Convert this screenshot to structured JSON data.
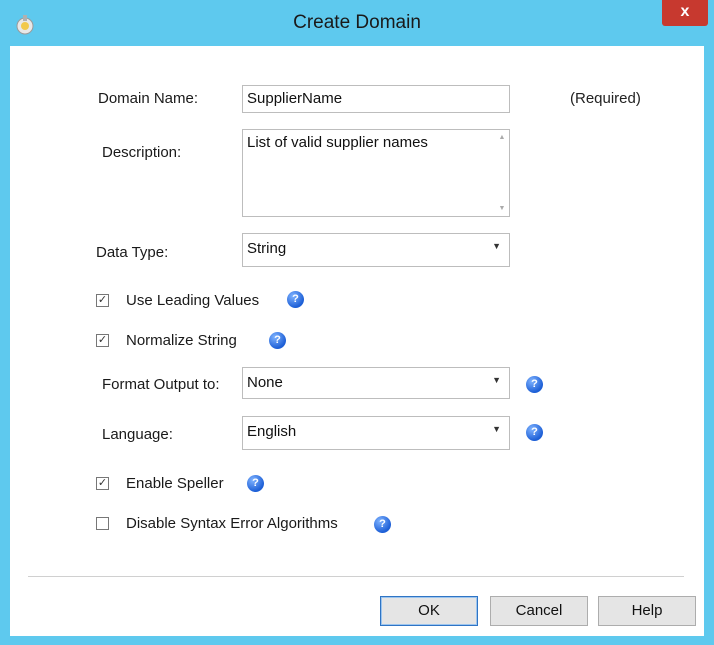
{
  "window": {
    "title": "Create Domain",
    "close_label": "x"
  },
  "form": {
    "domain_name": {
      "label": "Domain Name:",
      "value": "SupplierName",
      "required_note": "(Required)"
    },
    "description": {
      "label": "Description:",
      "value": "List of valid supplier names"
    },
    "data_type": {
      "label": "Data Type:",
      "value": "String"
    },
    "use_leading_values": {
      "label": "Use Leading Values",
      "checked": true
    },
    "normalize_string": {
      "label": "Normalize String",
      "checked": true
    },
    "format_output": {
      "label": "Format Output to:",
      "value": "None"
    },
    "language": {
      "label": "Language:",
      "value": "English"
    },
    "enable_speller": {
      "label": "Enable Speller",
      "checked": true
    },
    "disable_syntax": {
      "label": "Disable Syntax Error Algorithms",
      "checked": false
    }
  },
  "buttons": {
    "ok": "OK",
    "cancel": "Cancel",
    "help": "Help"
  },
  "icons": {
    "help": "help-question-icon",
    "checkbox_mark": "✓"
  },
  "colors": {
    "titlebar": "#5ec9ee",
    "close": "#c7392f",
    "help_icon": "#1d5fd6"
  }
}
